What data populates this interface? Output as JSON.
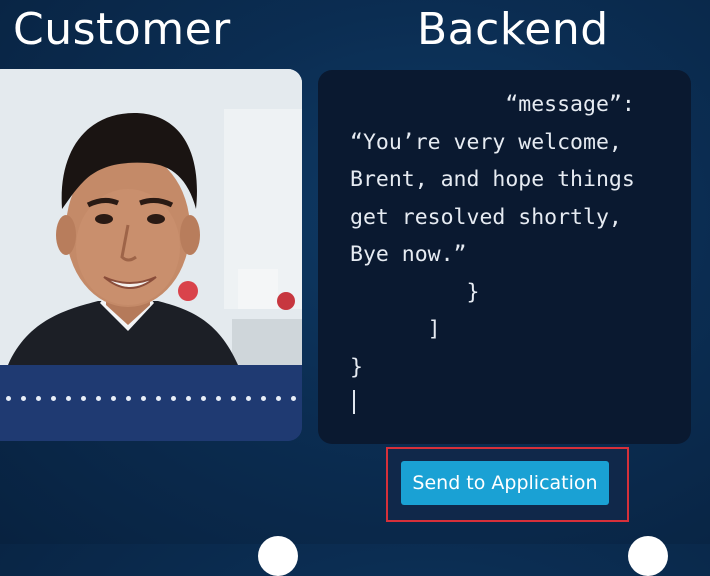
{
  "headers": {
    "customer": "Customer",
    "backend": "Backend"
  },
  "customer": {
    "photo_icon": "customer-video-feed",
    "audio_indicator": "audio-dots"
  },
  "backend": {
    "code_lines": [
      "            “message”:",
      "“You’re very welcome,",
      "Brent, and hope things",
      "get resolved shortly,",
      "Bye now.”",
      "         }",
      "      ]",
      "}"
    ]
  },
  "actions": {
    "send_label": "Send to Application"
  },
  "colors": {
    "accent": "#1aa1d4",
    "highlight": "#d6303a",
    "background": "#0b2d52"
  }
}
